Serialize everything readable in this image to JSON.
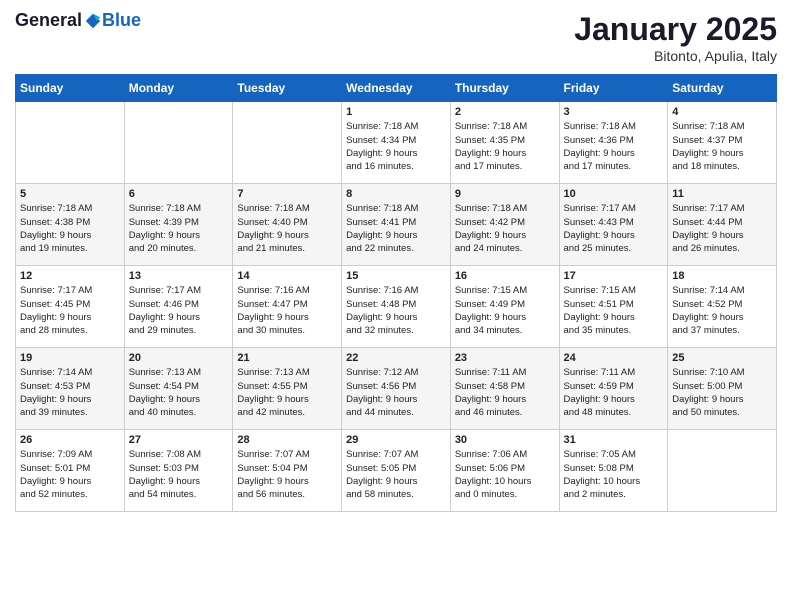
{
  "logo": {
    "general": "General",
    "blue": "Blue"
  },
  "header": {
    "month": "January 2025",
    "location": "Bitonto, Apulia, Italy"
  },
  "weekdays": [
    "Sunday",
    "Monday",
    "Tuesday",
    "Wednesday",
    "Thursday",
    "Friday",
    "Saturday"
  ],
  "weeks": [
    [
      {
        "day": "",
        "info": ""
      },
      {
        "day": "",
        "info": ""
      },
      {
        "day": "",
        "info": ""
      },
      {
        "day": "1",
        "info": "Sunrise: 7:18 AM\nSunset: 4:34 PM\nDaylight: 9 hours\nand 16 minutes."
      },
      {
        "day": "2",
        "info": "Sunrise: 7:18 AM\nSunset: 4:35 PM\nDaylight: 9 hours\nand 17 minutes."
      },
      {
        "day": "3",
        "info": "Sunrise: 7:18 AM\nSunset: 4:36 PM\nDaylight: 9 hours\nand 17 minutes."
      },
      {
        "day": "4",
        "info": "Sunrise: 7:18 AM\nSunset: 4:37 PM\nDaylight: 9 hours\nand 18 minutes."
      }
    ],
    [
      {
        "day": "5",
        "info": "Sunrise: 7:18 AM\nSunset: 4:38 PM\nDaylight: 9 hours\nand 19 minutes."
      },
      {
        "day": "6",
        "info": "Sunrise: 7:18 AM\nSunset: 4:39 PM\nDaylight: 9 hours\nand 20 minutes."
      },
      {
        "day": "7",
        "info": "Sunrise: 7:18 AM\nSunset: 4:40 PM\nDaylight: 9 hours\nand 21 minutes."
      },
      {
        "day": "8",
        "info": "Sunrise: 7:18 AM\nSunset: 4:41 PM\nDaylight: 9 hours\nand 22 minutes."
      },
      {
        "day": "9",
        "info": "Sunrise: 7:18 AM\nSunset: 4:42 PM\nDaylight: 9 hours\nand 24 minutes."
      },
      {
        "day": "10",
        "info": "Sunrise: 7:17 AM\nSunset: 4:43 PM\nDaylight: 9 hours\nand 25 minutes."
      },
      {
        "day": "11",
        "info": "Sunrise: 7:17 AM\nSunset: 4:44 PM\nDaylight: 9 hours\nand 26 minutes."
      }
    ],
    [
      {
        "day": "12",
        "info": "Sunrise: 7:17 AM\nSunset: 4:45 PM\nDaylight: 9 hours\nand 28 minutes."
      },
      {
        "day": "13",
        "info": "Sunrise: 7:17 AM\nSunset: 4:46 PM\nDaylight: 9 hours\nand 29 minutes."
      },
      {
        "day": "14",
        "info": "Sunrise: 7:16 AM\nSunset: 4:47 PM\nDaylight: 9 hours\nand 30 minutes."
      },
      {
        "day": "15",
        "info": "Sunrise: 7:16 AM\nSunset: 4:48 PM\nDaylight: 9 hours\nand 32 minutes."
      },
      {
        "day": "16",
        "info": "Sunrise: 7:15 AM\nSunset: 4:49 PM\nDaylight: 9 hours\nand 34 minutes."
      },
      {
        "day": "17",
        "info": "Sunrise: 7:15 AM\nSunset: 4:51 PM\nDaylight: 9 hours\nand 35 minutes."
      },
      {
        "day": "18",
        "info": "Sunrise: 7:14 AM\nSunset: 4:52 PM\nDaylight: 9 hours\nand 37 minutes."
      }
    ],
    [
      {
        "day": "19",
        "info": "Sunrise: 7:14 AM\nSunset: 4:53 PM\nDaylight: 9 hours\nand 39 minutes."
      },
      {
        "day": "20",
        "info": "Sunrise: 7:13 AM\nSunset: 4:54 PM\nDaylight: 9 hours\nand 40 minutes."
      },
      {
        "day": "21",
        "info": "Sunrise: 7:13 AM\nSunset: 4:55 PM\nDaylight: 9 hours\nand 42 minutes."
      },
      {
        "day": "22",
        "info": "Sunrise: 7:12 AM\nSunset: 4:56 PM\nDaylight: 9 hours\nand 44 minutes."
      },
      {
        "day": "23",
        "info": "Sunrise: 7:11 AM\nSunset: 4:58 PM\nDaylight: 9 hours\nand 46 minutes."
      },
      {
        "day": "24",
        "info": "Sunrise: 7:11 AM\nSunset: 4:59 PM\nDaylight: 9 hours\nand 48 minutes."
      },
      {
        "day": "25",
        "info": "Sunrise: 7:10 AM\nSunset: 5:00 PM\nDaylight: 9 hours\nand 50 minutes."
      }
    ],
    [
      {
        "day": "26",
        "info": "Sunrise: 7:09 AM\nSunset: 5:01 PM\nDaylight: 9 hours\nand 52 minutes."
      },
      {
        "day": "27",
        "info": "Sunrise: 7:08 AM\nSunset: 5:03 PM\nDaylight: 9 hours\nand 54 minutes."
      },
      {
        "day": "28",
        "info": "Sunrise: 7:07 AM\nSunset: 5:04 PM\nDaylight: 9 hours\nand 56 minutes."
      },
      {
        "day": "29",
        "info": "Sunrise: 7:07 AM\nSunset: 5:05 PM\nDaylight: 9 hours\nand 58 minutes."
      },
      {
        "day": "30",
        "info": "Sunrise: 7:06 AM\nSunset: 5:06 PM\nDaylight: 10 hours\nand 0 minutes."
      },
      {
        "day": "31",
        "info": "Sunrise: 7:05 AM\nSunset: 5:08 PM\nDaylight: 10 hours\nand 2 minutes."
      },
      {
        "day": "",
        "info": ""
      }
    ]
  ]
}
